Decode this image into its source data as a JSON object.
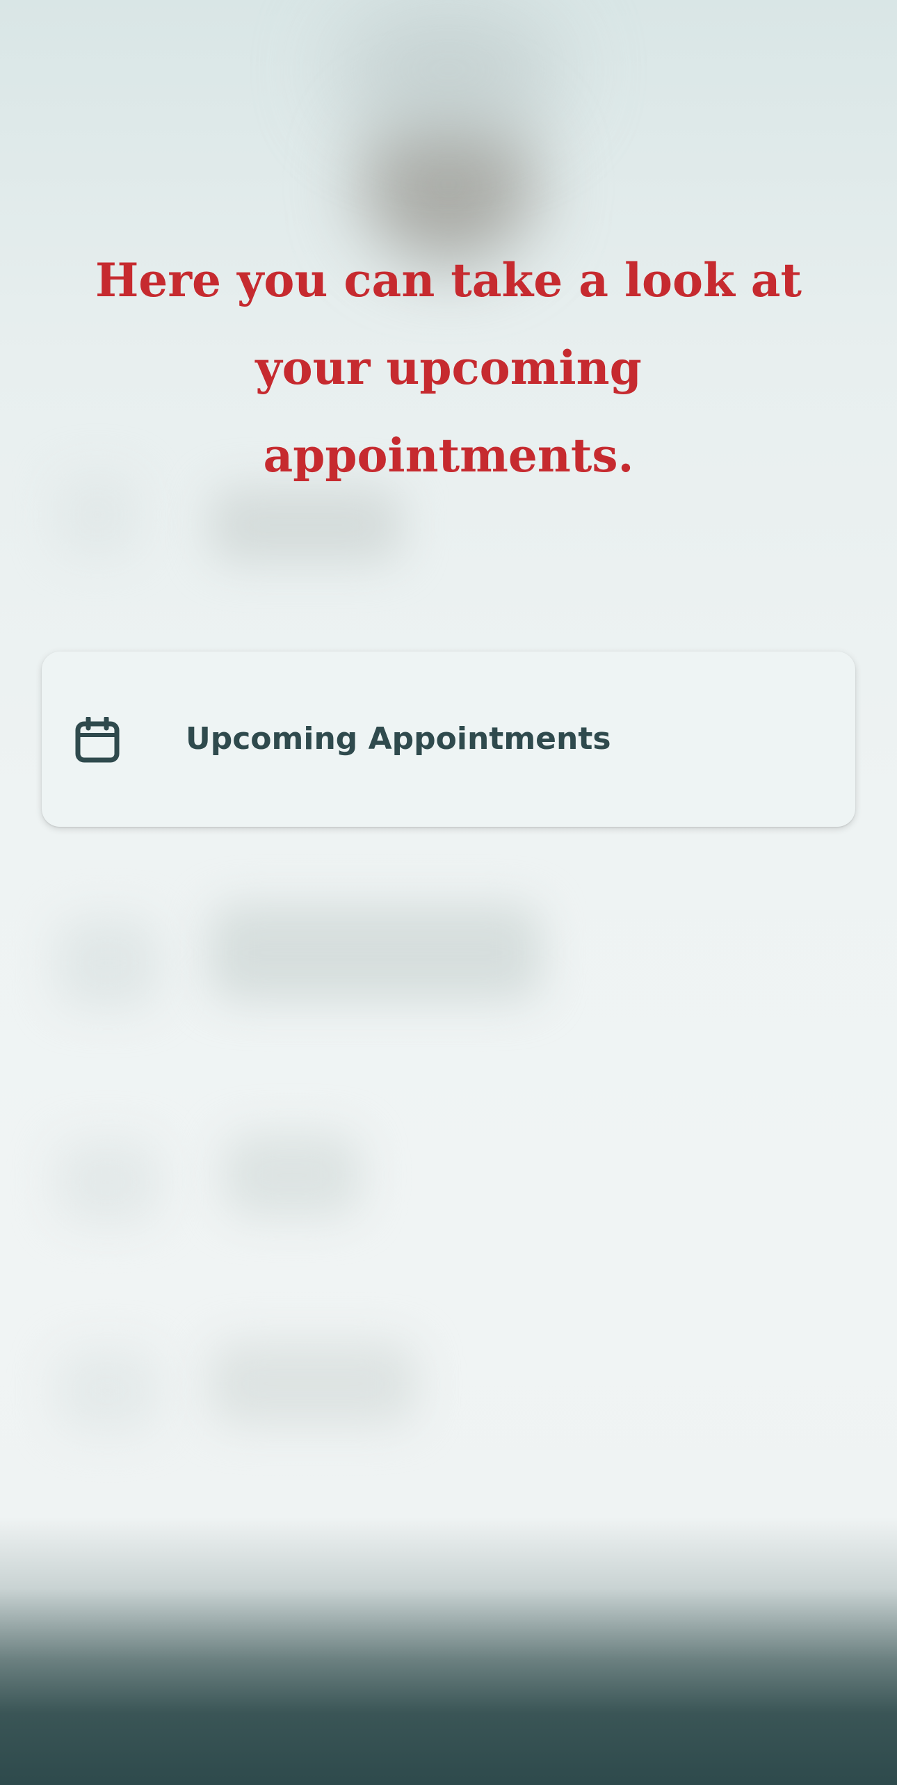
{
  "onboarding": {
    "message": "Here you can take a look at your upcoming appointments."
  },
  "highlighted_item": {
    "label": "Upcoming Appointments",
    "icon": "calendar-icon"
  },
  "colors": {
    "message_text": "#c62a2f",
    "item_text": "#2f4a4d",
    "card_background": "#eef4f4",
    "bottom_bar": "#2e4a4c"
  }
}
